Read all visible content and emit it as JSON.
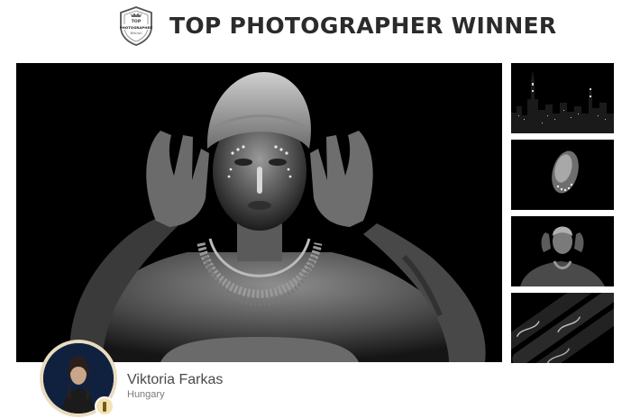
{
  "header": {
    "title": "TOP PHOTOGRAPHER WINNER",
    "badge": {
      "icon": "award-shield-icon",
      "line1": "TOP",
      "line2": "PHOTOGRAPHER",
      "line3": "Winner"
    }
  },
  "photographer": {
    "name": "Viktoria Farkas",
    "country": "Hungary",
    "medal_icon": "medal-icon"
  },
  "colors": {
    "title": "#2b2b2b",
    "name": "#4a4a4a",
    "country": "#7a7a7a",
    "avatar_ring": "#e9dcc0",
    "medal": "#f3e3b3"
  }
}
